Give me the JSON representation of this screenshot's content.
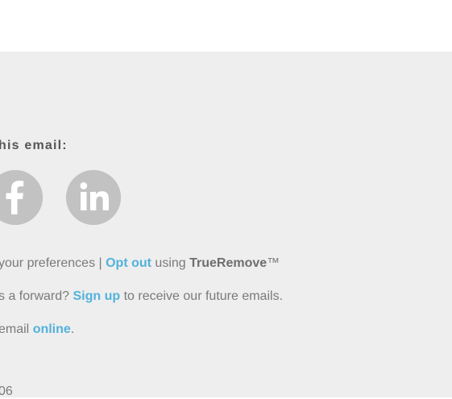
{
  "share": {
    "heading": "his email:",
    "icons": [
      "facebook-icon",
      "linkedin-icon"
    ],
    "icon_color": "#c2c2c2"
  },
  "footer": {
    "line1": {
      "prefix": "your preferences | ",
      "opt_out_link": "Opt out",
      "middle": " using ",
      "brand": "TrueRemove",
      "suffix": "™"
    },
    "line2": {
      "prefix": "s a forward? ",
      "signup_link": "Sign up",
      "suffix": " to receive our future emails."
    },
    "line3": {
      "prefix": "email ",
      "online_link": "online",
      "suffix": "."
    },
    "line4": {
      "text": "06"
    }
  },
  "colors": {
    "background": "#eeeeee",
    "link": "#52b2dc",
    "text": "#7a7a7a",
    "heading": "#555555"
  }
}
